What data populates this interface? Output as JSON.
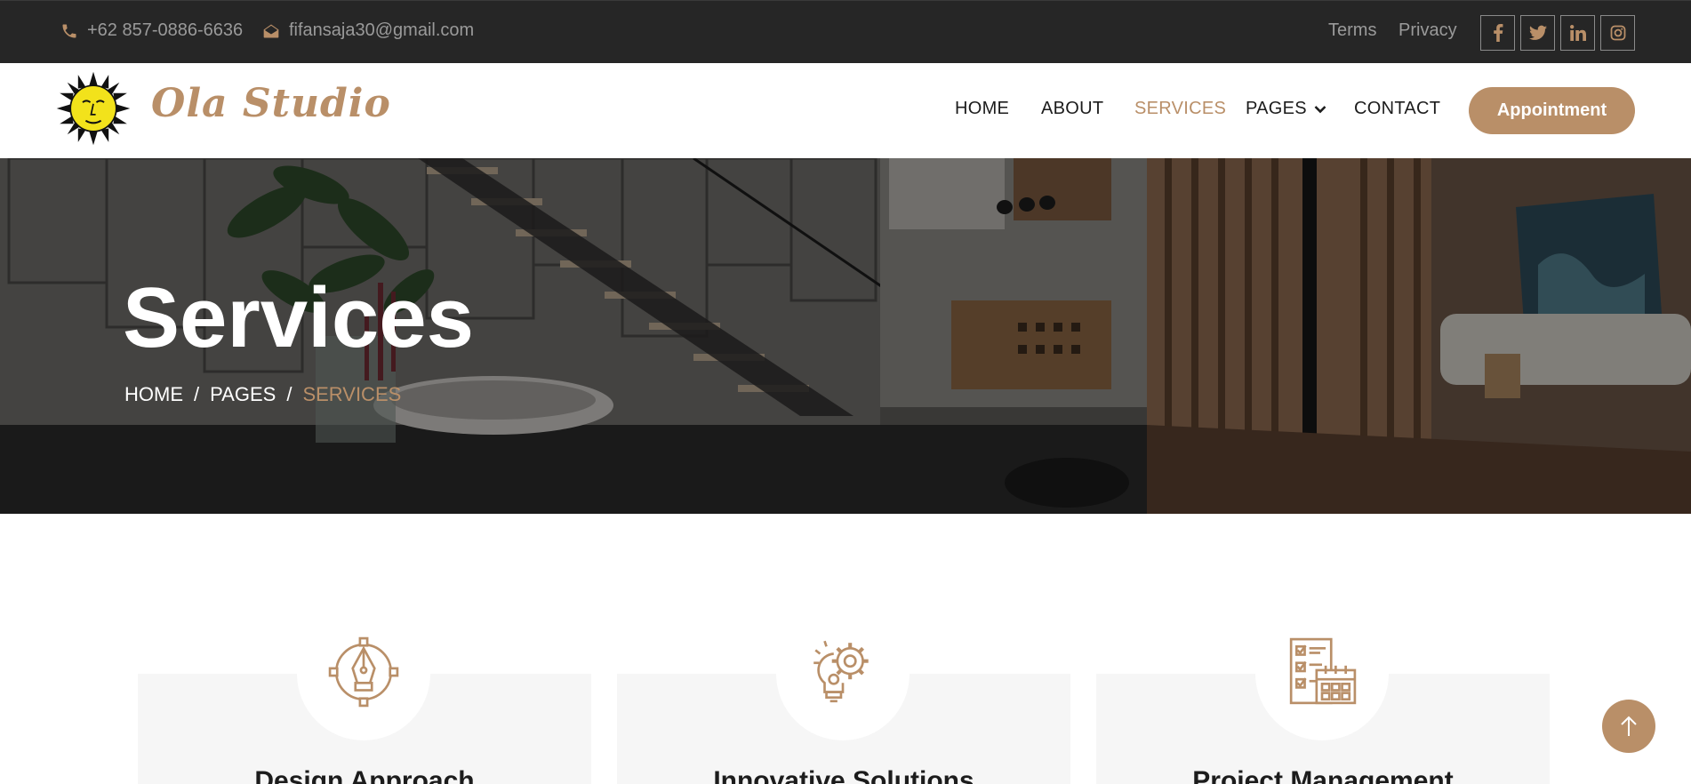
{
  "topbar": {
    "phone": "+62 857-0886-6636",
    "email": "fifansaja30@gmail.com",
    "links": [
      "Terms",
      "Privacy"
    ],
    "social": [
      "facebook-icon",
      "twitter-icon",
      "linkedin-icon",
      "instagram-icon"
    ]
  },
  "brand": {
    "name": "Ola Studio",
    "logo": "sun-face-logo"
  },
  "nav": {
    "items": [
      "HOME",
      "ABOUT",
      "SERVICES",
      "PAGES",
      "CONTACT"
    ],
    "active": "SERVICES",
    "cta": "Appointment"
  },
  "hero": {
    "title": "Services",
    "breadcrumb": [
      "HOME",
      "PAGES",
      "SERVICES"
    ],
    "separator": "/"
  },
  "services": [
    {
      "title": "Design Approach",
      "icon": "pen-tool-icon"
    },
    {
      "title": "Innovative Solutions",
      "icon": "lightbulb-gear-icon"
    },
    {
      "title": "Project Management",
      "icon": "checklist-calendar-icon"
    }
  ],
  "colors": {
    "accent": "#b98f68",
    "topbar": "#262626",
    "card": "#f6f6f6"
  },
  "scroll_top": "arrow-up-icon"
}
